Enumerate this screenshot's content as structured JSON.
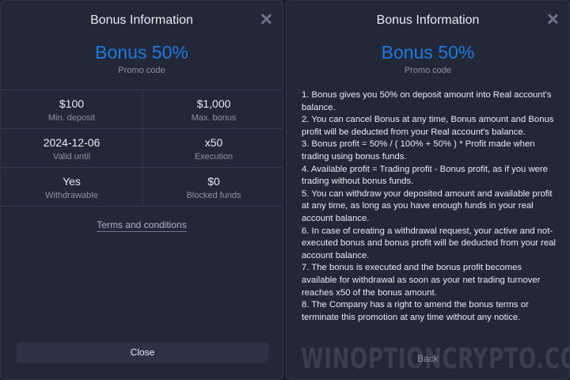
{
  "left": {
    "title": "Bonus Information",
    "bonus_heading": "Bonus 50%",
    "promo_label": "Promo code",
    "grid": [
      {
        "value": "$100",
        "label": "Min. deposit"
      },
      {
        "value": "$1,000",
        "label": "Max. bonus"
      },
      {
        "value": "2024-12-06",
        "label": "Valid until"
      },
      {
        "value": "x50",
        "label": "Execution"
      },
      {
        "value": "Yes",
        "label": "Withdrawable"
      },
      {
        "value": "$0",
        "label": "Blocked funds"
      }
    ],
    "terms_link": "Terms and conditions",
    "close_button": "Close"
  },
  "right": {
    "title": "Bonus Information",
    "bonus_heading": "Bonus 50%",
    "promo_label": "Promo code",
    "terms": [
      "1. Bonus gives you 50% on deposit amount into Real account's balance.",
      "2. You can cancel Bonus at any time, Bonus amount and Bonus profit will be deducted from your Real account's balance.",
      "3. Bonus profit = 50% / ( 100% + 50% ) * Profit made when trading using bonus funds.",
      "4. Available profit = Trading profit - Bonus profit, as if you were trading without bonus funds.",
      "5. You can withdraw your deposited amount and available profit at any time, as long as you have enough funds in your real account balance.",
      "6. In case of creating a withdrawal request, your active and not-executed bonus and bonus profit will be deducted from your real account balance.",
      "7. The bonus is executed and the bonus profit becomes available for withdrawal as soon as your net trading turnover reaches x50 of the bonus amount.",
      "8. The Company has a right to amend the bonus terms or terminate this promotion at any time without any notice."
    ],
    "back_button": "Back"
  },
  "watermark": "WINOPTIONCRYPTO.COM",
  "icons": {
    "close": "close-icon"
  },
  "colors": {
    "accent": "#1f7ae0",
    "panel_bg": "#222838",
    "text": "#e8ebf2",
    "muted": "#8c93a3"
  }
}
